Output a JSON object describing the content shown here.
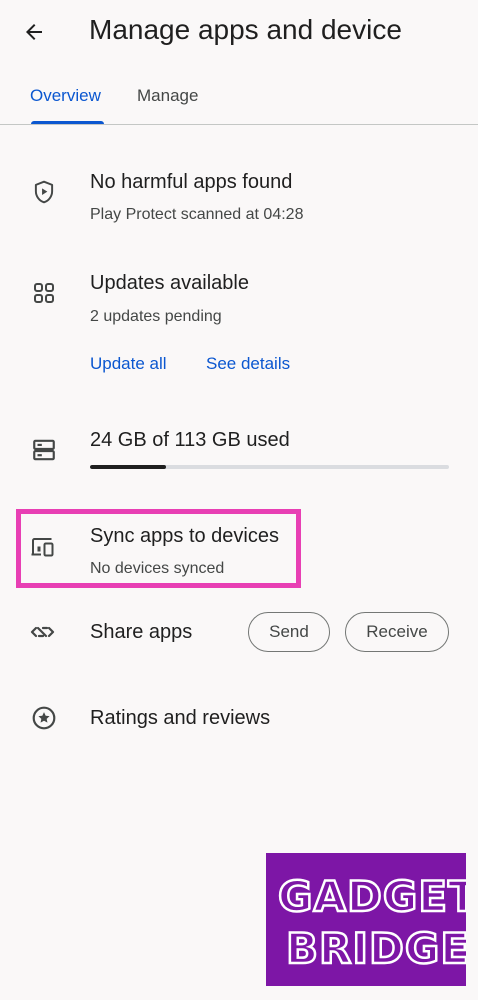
{
  "header": {
    "title": "Manage apps and device",
    "back_icon": "arrow-back-icon"
  },
  "tabs": [
    {
      "label": "Overview",
      "selected": true
    },
    {
      "label": "Manage",
      "selected": false
    }
  ],
  "colors": {
    "accent": "#0b57d0",
    "background": "#faf8f8",
    "highlight": "#e83fb4",
    "watermark": "#7d16a6"
  },
  "protect": {
    "icon": "play-protect-shield-icon",
    "title": "No harmful apps found",
    "subtitle": "Play Protect scanned at 04:28"
  },
  "updates": {
    "icon": "apps-grid-icon",
    "title": "Updates available",
    "subtitle": "2 updates pending",
    "update_all_label": "Update all",
    "see_details_label": "See details"
  },
  "storage": {
    "icon": "storage-icon",
    "title": "24 GB of 113 GB used",
    "used_gb": 24,
    "total_gb": 113
  },
  "sync": {
    "icon": "devices-icon",
    "title": "Sync apps to devices",
    "subtitle": "No devices synced"
  },
  "share": {
    "icon": "nearby-share-icon",
    "title": "Share apps",
    "send_label": "Send",
    "receive_label": "Receive"
  },
  "ratings": {
    "icon": "star-circle-icon",
    "title": "Ratings and reviews"
  },
  "watermark": {
    "line1": "GADGET",
    "line2": "BRIDGE"
  }
}
